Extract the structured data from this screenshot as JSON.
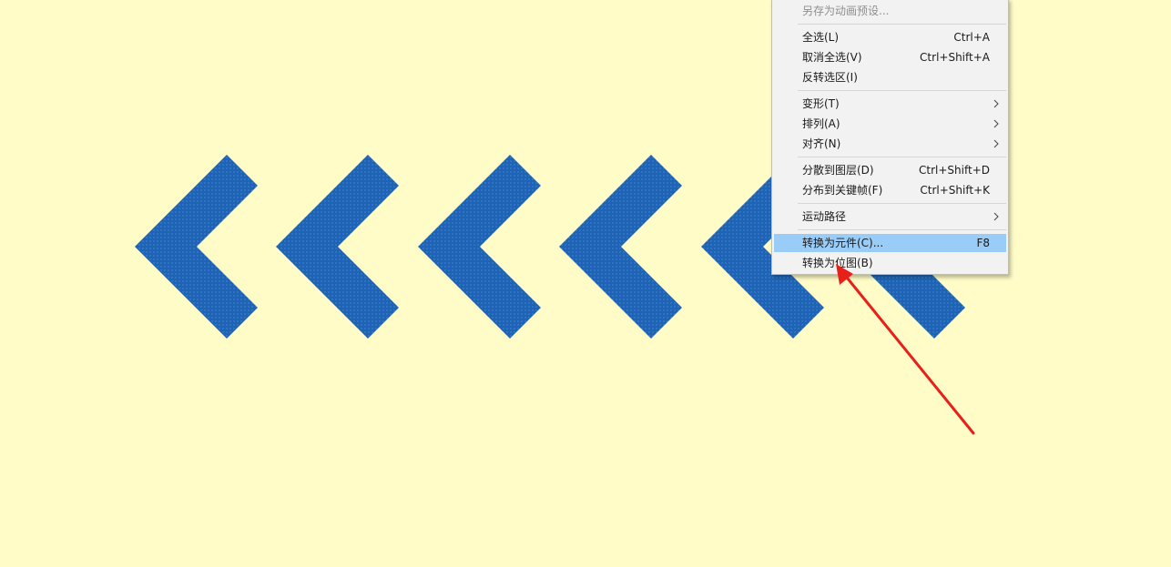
{
  "canvas": {
    "background_color": "#FFFCC8",
    "shape_color": "#1F64B4",
    "shape_pattern_color": "#3C7ED0",
    "shapes": [
      {
        "name": "chevron-left-shape-1"
      },
      {
        "name": "chevron-left-shape-2"
      },
      {
        "name": "chevron-left-shape-3"
      },
      {
        "name": "chevron-left-shape-4"
      },
      {
        "name": "chevron-left-shape-5"
      },
      {
        "name": "chevron-left-shape-6"
      }
    ]
  },
  "context_menu": {
    "items": [
      {
        "label": "另存为动画预设...",
        "shortcut": "",
        "submenu": false,
        "disabled": true,
        "highlighted": false
      },
      {
        "label": "全选(L)",
        "shortcut": "Ctrl+A",
        "submenu": false,
        "disabled": false,
        "highlighted": false
      },
      {
        "label": "取消全选(V)",
        "shortcut": "Ctrl+Shift+A",
        "submenu": false,
        "disabled": false,
        "highlighted": false
      },
      {
        "label": "反转选区(I)",
        "shortcut": "",
        "submenu": false,
        "disabled": false,
        "highlighted": false
      },
      {
        "label": "变形(T)",
        "shortcut": "",
        "submenu": true,
        "disabled": false,
        "highlighted": false
      },
      {
        "label": "排列(A)",
        "shortcut": "",
        "submenu": true,
        "disabled": false,
        "highlighted": false
      },
      {
        "label": "对齐(N)",
        "shortcut": "",
        "submenu": true,
        "disabled": false,
        "highlighted": false
      },
      {
        "label": "分散到图层(D)",
        "shortcut": "Ctrl+Shift+D",
        "submenu": false,
        "disabled": false,
        "highlighted": false
      },
      {
        "label": "分布到关键帧(F)",
        "shortcut": "Ctrl+Shift+K",
        "submenu": false,
        "disabled": false,
        "highlighted": false
      },
      {
        "label": "运动路径",
        "shortcut": "",
        "submenu": true,
        "disabled": false,
        "highlighted": false
      },
      {
        "label": "转换为元件(C)...",
        "shortcut": "F8",
        "submenu": false,
        "disabled": false,
        "highlighted": true
      },
      {
        "label": "转换为位图(B)",
        "shortcut": "",
        "submenu": false,
        "disabled": false,
        "highlighted": false
      }
    ],
    "highlight_color": "#99CCF7"
  },
  "annotation": {
    "arrow_color": "#E8201A",
    "points_to": "转换为位图(B)"
  }
}
